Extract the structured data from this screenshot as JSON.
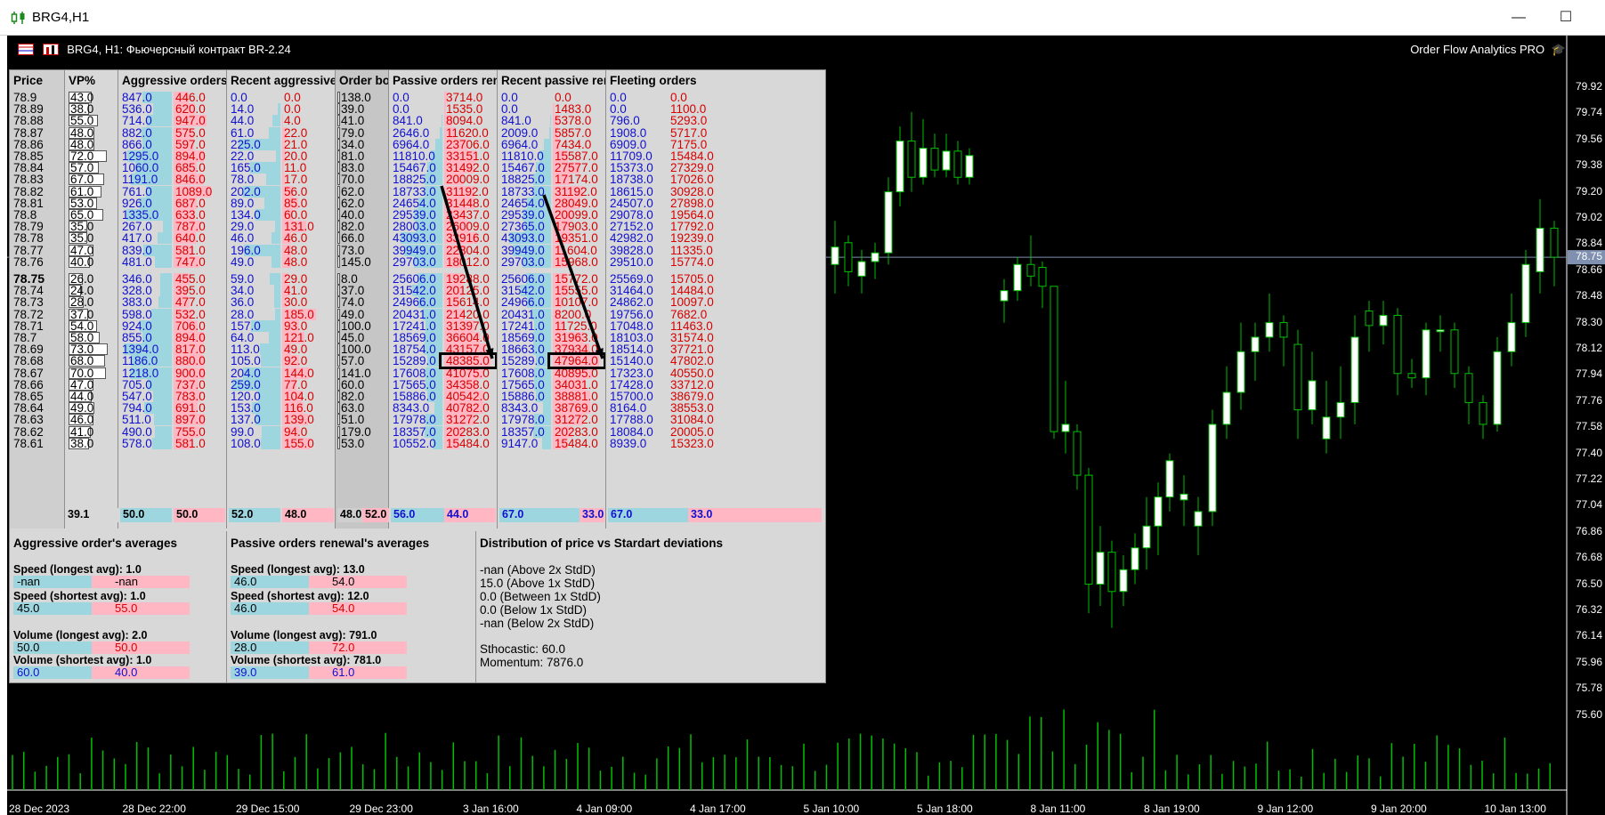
{
  "window": {
    "title": "BRG4,H1",
    "minimize": "—",
    "maximize": "☐",
    "close": "✕"
  },
  "chart": {
    "header": "BRG4, H1:  Фьючерсный контракт BR-2.24",
    "brand": "Order Flow Analytics PRO",
    "current_price_tag": "78.75",
    "y_labels": [
      "79.92",
      "79.74",
      "79.56",
      "79.38",
      "79.20",
      "79.02",
      "78.84",
      "78.66",
      "78.48",
      "78.30",
      "78.12",
      "77.94",
      "77.76",
      "77.58",
      "77.40",
      "77.22",
      "77.04",
      "76.86",
      "76.68",
      "76.50",
      "76.32",
      "76.14",
      "75.96",
      "75.78",
      "75.60"
    ],
    "x_labels": [
      "28 Dec 2023",
      "28 Dec 22:00",
      "29 Dec 15:00",
      "29 Dec 23:00",
      "3 Jan 16:00",
      "4 Jan 09:00",
      "4 Jan 17:00",
      "5 Jan 10:00",
      "5 Jan 18:00",
      "8 Jan 11:00",
      "8 Jan 19:00",
      "9 Jan 12:00",
      "9 Jan 20:00",
      "10 Jan 13:00"
    ],
    "colors": {
      "bull": "#ffffff",
      "bear": "#000000",
      "wick": "#00c000",
      "volume": "#00c000",
      "priceline": "#8090b0"
    }
  },
  "panel": {
    "headers": {
      "price": "Price",
      "vp": "VP%",
      "aggr": "Aggressive orders",
      "raggr": "Recent aggressive ord",
      "book": "Order boo",
      "passive": "Passive orders renewa",
      "rpassive": "Recent passive renew",
      "fleeting": "Fleeting orders"
    },
    "rows": [
      {
        "p": "78.9",
        "vp": "43.0",
        "a1": "847.0",
        "a2": "446.0",
        "ra1": "0.0",
        "ra2": "0.0",
        "ob": "138.0",
        "pa1": "0.0",
        "pa2": "3714.0",
        "rp1": "0.0",
        "rp2": "0.0",
        "f1": "0.0",
        "f2": "0.0"
      },
      {
        "p": "78.89",
        "vp": "38.0",
        "a1": "536.0",
        "a2": "620.0",
        "ra1": "14.0",
        "ra2": "0.0",
        "ob": "39.0",
        "pa1": "0.0",
        "pa2": "1535.0",
        "rp1": "0.0",
        "rp2": "1483.0",
        "f1": "0.0",
        "f2": "1100.0"
      },
      {
        "p": "78.88",
        "vp": "55.0",
        "a1": "714.0",
        "a2": "947.0",
        "ra1": "44.0",
        "ra2": "4.0",
        "ob": "41.0",
        "pa1": "841.0",
        "pa2": "8094.0",
        "rp1": "841.0",
        "rp2": "5378.0",
        "f1": "796.0",
        "f2": "5293.0"
      },
      {
        "p": "78.87",
        "vp": "48.0",
        "a1": "882.0",
        "a2": "575.0",
        "ra1": "61.0",
        "ra2": "22.0",
        "ob": "79.0",
        "pa1": "2646.0",
        "pa2": "11620.0",
        "rp1": "2009.0",
        "rp2": "5857.0",
        "f1": "1908.0",
        "f2": "5717.0"
      },
      {
        "p": "78.86",
        "vp": "48.0",
        "a1": "866.0",
        "a2": "597.0",
        "ra1": "225.0",
        "ra2": "21.0",
        "ob": "34.0",
        "pa1": "6964.0",
        "pa2": "23706.0",
        "rp1": "6964.0",
        "rp2": "7434.0",
        "f1": "6909.0",
        "f2": "7175.0"
      },
      {
        "p": "78.85",
        "vp": "72.0",
        "a1": "1295.0",
        "a2": "894.0",
        "ra1": "22.0",
        "ra2": "20.0",
        "ob": "81.0",
        "pa1": "11810.0",
        "pa2": "33151.0",
        "rp1": "11810.0",
        "rp2": "15587.0",
        "f1": "11709.0",
        "f2": "15484.0"
      },
      {
        "p": "78.84",
        "vp": "57.0",
        "a1": "1060.0",
        "a2": "685.0",
        "ra1": "165.0",
        "ra2": "11.0",
        "ob": "83.0",
        "pa1": "15467.0",
        "pa2": "31492.0",
        "rp1": "15467.0",
        "rp2": "27577.0",
        "f1": "15373.0",
        "f2": "27329.0"
      },
      {
        "p": "78.83",
        "vp": "67.0",
        "a1": "1191.0",
        "a2": "846.0",
        "ra1": "78.0",
        "ra2": "17.0",
        "ob": "70.0",
        "pa1": "18825.0",
        "pa2": "20009.0",
        "rp1": "18825.0",
        "rp2": "17174.0",
        "f1": "18738.0",
        "f2": "17026.0"
      },
      {
        "p": "78.82",
        "vp": "61.0",
        "a1": "761.0",
        "a2": "1089.0",
        "ra1": "202.0",
        "ra2": "56.0",
        "ob": "62.0",
        "pa1": "18733.0",
        "pa2": "31192.0",
        "rp1": "18733.0",
        "rp2": "31192.0",
        "f1": "18615.0",
        "f2": "30928.0"
      },
      {
        "p": "78.81",
        "vp": "53.0",
        "a1": "926.0",
        "a2": "687.0",
        "ra1": "89.0",
        "ra2": "85.0",
        "ob": "62.0",
        "pa1": "24654.0",
        "pa2": "31448.0",
        "rp1": "24654.0",
        "rp2": "28049.0",
        "f1": "24507.0",
        "f2": "27898.0"
      },
      {
        "p": "78.8",
        "vp": "65.0",
        "a1": "1335.0",
        "a2": "633.0",
        "ra1": "134.0",
        "ra2": "60.0",
        "ob": "40.0",
        "pa1": "29539.0",
        "pa2": "23437.0",
        "rp1": "29539.0",
        "rp2": "20099.0",
        "f1": "29078.0",
        "f2": "19564.0"
      },
      {
        "p": "78.79",
        "vp": "35.0",
        "a1": "267.0",
        "a2": "787.0",
        "ra1": "29.0",
        "ra2": "131.0",
        "ob": "82.0",
        "pa1": "28003.0",
        "pa2": "26009.0",
        "rp1": "27365.0",
        "rp2": "17903.0",
        "f1": "27152.0",
        "f2": "17792.0"
      },
      {
        "p": "78.78",
        "vp": "35.0",
        "a1": "417.0",
        "a2": "640.0",
        "ra1": "46.0",
        "ra2": "46.0",
        "ob": "66.0",
        "pa1": "43093.0",
        "pa2": "33916.0",
        "rp1": "43093.0",
        "rp2": "19351.0",
        "f1": "42982.0",
        "f2": "19239.0"
      },
      {
        "p": "78.77",
        "vp": "47.0",
        "a1": "839.0",
        "a2": "581.0",
        "ra1": "196.0",
        "ra2": "48.0",
        "ob": "73.0",
        "pa1": "39949.0",
        "pa2": "22804.0",
        "rp1": "39949.0",
        "rp2": "11604.0",
        "f1": "39828.0",
        "f2": "11335.0"
      },
      {
        "p": "78.76",
        "vp": "40.0",
        "a1": "481.0",
        "a2": "747.0",
        "ra1": "49.0",
        "ra2": "48.0",
        "ob": "145.0",
        "pa1": "29703.0",
        "pa2": "18012.0",
        "rp1": "29703.0",
        "rp2": "15968.0",
        "f1": "29510.0",
        "f2": "15774.0"
      },
      {
        "p": "78.75",
        "vp": "26.0",
        "a1": "346.0",
        "a2": "455.0",
        "ra1": "59.0",
        "ra2": "29.0",
        "ob": "8.0",
        "pa1": "25606.0",
        "pa2": "19288.0",
        "rp1": "25606.0",
        "rp2": "15772.0",
        "f1": "25569.0",
        "f2": "15705.0"
      },
      {
        "p": "78.74",
        "vp": "24.0",
        "a1": "328.0",
        "a2": "395.0",
        "ra1": "34.0",
        "ra2": "41.0",
        "ob": "37.0",
        "pa1": "31542.0",
        "pa2": "20125.0",
        "rp1": "31542.0",
        "rp2": "15555.0",
        "f1": "31464.0",
        "f2": "14484.0"
      },
      {
        "p": "78.73",
        "vp": "28.0",
        "a1": "383.0",
        "a2": "477.0",
        "ra1": "36.0",
        "ra2": "30.0",
        "ob": "74.0",
        "pa1": "24966.0",
        "pa2": "15614.0",
        "rp1": "24966.0",
        "rp2": "10107.0",
        "f1": "24862.0",
        "f2": "10097.0"
      },
      {
        "p": "78.72",
        "vp": "37.0",
        "a1": "598.0",
        "a2": "532.0",
        "ra1": "28.0",
        "ra2": "185.0",
        "ob": "49.0",
        "pa1": "20431.0",
        "pa2": "21420.0",
        "rp1": "20431.0",
        "rp2": "8200.0",
        "f1": "19756.0",
        "f2": "7682.0"
      },
      {
        "p": "78.71",
        "vp": "54.0",
        "a1": "924.0",
        "a2": "706.0",
        "ra1": "157.0",
        "ra2": "93.0",
        "ob": "100.0",
        "pa1": "17241.0",
        "pa2": "31397.0",
        "rp1": "17241.0",
        "rp2": "11725.0",
        "f1": "17048.0",
        "f2": "11463.0"
      },
      {
        "p": "78.7",
        "vp": "58.0",
        "a1": "855.0",
        "a2": "894.0",
        "ra1": "64.0",
        "ra2": "121.0",
        "ob": "45.0",
        "pa1": "18569.0",
        "pa2": "36604.0",
        "rp1": "18569.0",
        "rp2": "31963.0",
        "f1": "18103.0",
        "f2": "31574.0"
      },
      {
        "p": "78.69",
        "vp": "73.0",
        "a1": "1394.0",
        "a2": "817.0",
        "ra1": "113.0",
        "ra2": "49.0",
        "ob": "100.0",
        "pa1": "18754.0",
        "pa2": "43157.0",
        "rp1": "18663.0",
        "rp2": "37934.0",
        "f1": "18514.0",
        "f2": "37721.0"
      },
      {
        "p": "78.68",
        "vp": "68.0",
        "a1": "1186.0",
        "a2": "880.0",
        "ra1": "105.0",
        "ra2": "92.0",
        "ob": "57.0",
        "pa1": "15289.0",
        "pa2": "48385.0",
        "rp1": "15289.0",
        "rp2": "47964.0",
        "f1": "15140.0",
        "f2": "47802.0"
      },
      {
        "p": "78.67",
        "vp": "70.0",
        "a1": "1218.0",
        "a2": "900.0",
        "ra1": "204.0",
        "ra2": "144.0",
        "ob": "141.0",
        "pa1": "17608.0",
        "pa2": "41075.0",
        "rp1": "17608.0",
        "rp2": "40895.0",
        "f1": "17323.0",
        "f2": "40550.0"
      },
      {
        "p": "78.66",
        "vp": "47.0",
        "a1": "705.0",
        "a2": "737.0",
        "ra1": "259.0",
        "ra2": "77.0",
        "ob": "60.0",
        "pa1": "17565.0",
        "pa2": "34358.0",
        "rp1": "17565.0",
        "rp2": "34031.0",
        "f1": "17428.0",
        "f2": "33712.0"
      },
      {
        "p": "78.65",
        "vp": "44.0",
        "a1": "547.0",
        "a2": "783.0",
        "ra1": "120.0",
        "ra2": "104.0",
        "ob": "82.0",
        "pa1": "15886.0",
        "pa2": "40542.0",
        "rp1": "15886.0",
        "rp2": "38881.0",
        "f1": "15700.0",
        "f2": "38679.0"
      },
      {
        "p": "78.64",
        "vp": "49.0",
        "a1": "794.0",
        "a2": "691.0",
        "ra1": "153.0",
        "ra2": "116.0",
        "ob": "63.0",
        "pa1": "8343.0",
        "pa2": "40782.0",
        "rp1": "8343.0",
        "rp2": "38769.0",
        "f1": "8164.0",
        "f2": "38553.0"
      },
      {
        "p": "78.63",
        "vp": "46.0",
        "a1": "511.0",
        "a2": "897.0",
        "ra1": "137.0",
        "ra2": "139.0",
        "ob": "51.0",
        "pa1": "17978.0",
        "pa2": "31272.0",
        "rp1": "17978.0",
        "rp2": "31272.0",
        "f1": "17788.0",
        "f2": "31084.0"
      },
      {
        "p": "78.62",
        "vp": "41.0",
        "a1": "490.0",
        "a2": "755.0",
        "ra1": "99.0",
        "ra2": "94.0",
        "ob": "179.0",
        "pa1": "18357.0",
        "pa2": "20283.0",
        "rp1": "18357.0",
        "rp2": "20283.0",
        "f1": "18084.0",
        "f2": "20005.0"
      },
      {
        "p": "78.61",
        "vp": "38.0",
        "a1": "578.0",
        "a2": "581.0",
        "ra1": "108.0",
        "ra2": "155.0",
        "ob": "53.0",
        "pa1": "10552.0",
        "pa2": "15484.0",
        "rp1": "9147.0",
        "rp2": "15484.0",
        "f1": "8939.0",
        "f2": "15323.0"
      }
    ],
    "footer": {
      "vp": "39.1",
      "a1": "50.0",
      "a2": "50.0",
      "ra1": "52.0",
      "ra2": "48.0",
      "ob1": "48.0",
      "ob2": "52.0",
      "pa1": "56.0",
      "pa2": "44.0",
      "rp1": "67.0",
      "rp2": "33.0",
      "f1": "67.0",
      "f2": "33.0"
    },
    "aggr_avg": {
      "title": "Aggressive order's averages",
      "speed_long": "Speed (longest avg): 1.0",
      "sl_a": "-nan",
      "sl_b": "-nan",
      "speed_short": "Speed (shortest avg): 1.0",
      "ss_a": "45.0",
      "ss_b": "55.0",
      "vol_long": "Volume (longest avg): 2.0",
      "vl_a": "50.0",
      "vl_b": "50.0",
      "vol_short": "Volume (shortest avg): 1.0",
      "vs_a": "60.0",
      "vs_b": "40.0"
    },
    "pass_avg": {
      "title": "Passive orders renewal's averages",
      "speed_long": "Speed (longest avg): 13.0",
      "sl_a": "46.0",
      "sl_b": "54.0",
      "speed_short": "Speed (shortest avg): 12.0",
      "ss_a": "46.0",
      "ss_b": "54.0",
      "vol_long": "Volume (longest avg): 791.0",
      "vl_a": "28.0",
      "vl_b": "72.0",
      "vol_short": "Volume (shortest avg): 781.0",
      "vs_a": "39.0",
      "vs_b": "61.0"
    },
    "dist": {
      "title": "Distribution of price vs Stardart deviations",
      "l1": "-nan (Above 2x StdD)",
      "l2": "15.0 (Above 1x StdD)",
      "l3": "0.0 (Between 1x StdD)",
      "l4": "0.0 (Below 1x StdD)",
      "l5": "-nan (Below 2x StdD)",
      "stoch": "Sthocastic: 60.0",
      "mom": "Momentum: 7876.0"
    }
  }
}
